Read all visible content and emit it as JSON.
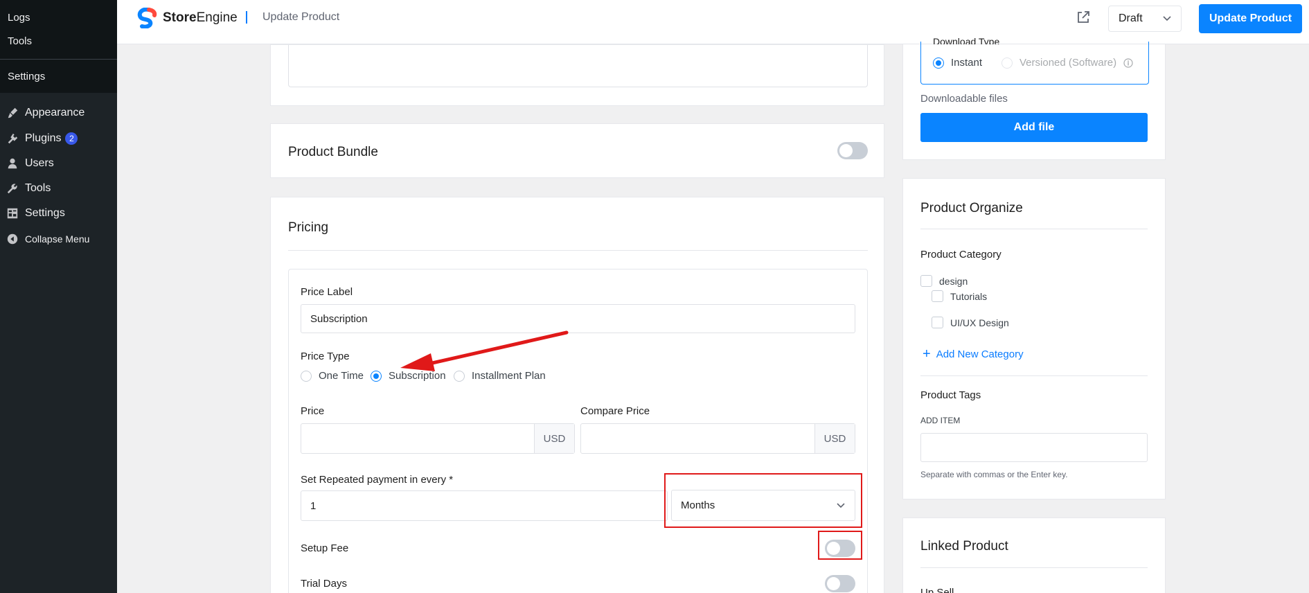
{
  "sidebar": {
    "submenu": [
      {
        "label": "Logs"
      },
      {
        "label": "Tools"
      },
      {
        "label": "Settings"
      }
    ],
    "menu": [
      {
        "label": "Appearance",
        "icon": "brush-icon"
      },
      {
        "label": "Plugins",
        "icon": "plugin-icon",
        "badge": "2"
      },
      {
        "label": "Users",
        "icon": "user-icon"
      },
      {
        "label": "Tools",
        "icon": "wrench-icon"
      },
      {
        "label": "Settings",
        "icon": "settings-icon"
      },
      {
        "label": "Collapse Menu",
        "icon": "collapse-icon"
      }
    ]
  },
  "topbar": {
    "logo_bold": "Store",
    "logo_rest": "Engine",
    "page_title": "Update Product",
    "status": "Draft",
    "update_label": "Update Product"
  },
  "bundle": {
    "title": "Product Bundle"
  },
  "pricing": {
    "title": "Pricing",
    "price_label_label": "Price Label",
    "price_label_value": "Subscription",
    "price_type_label": "Price Type",
    "price_types": [
      "One Time",
      "Subscription",
      "Installment Plan"
    ],
    "selected_price_type": "Subscription",
    "price_label": "Price",
    "compare_price_label": "Compare Price",
    "currency": "USD",
    "repeat_label": "Set Repeated payment in every *",
    "repeat_value": "1",
    "repeat_unit": "Months",
    "setup_fee_label": "Setup Fee",
    "trial_days_label": "Trial Days"
  },
  "download": {
    "type_label": "Download Type",
    "options": [
      "Instant",
      "Versioned (Software)"
    ],
    "files_label": "Downloadable files",
    "add_file_label": "Add file"
  },
  "organize": {
    "title": "Product Organize",
    "category_label": "Product Category",
    "categories": [
      "design",
      "Tutorials",
      "UI/UX Design"
    ],
    "add_category": "Add New Category",
    "tags_label": "Product Tags",
    "add_item_label": "ADD ITEM",
    "tags_help": "Separate with commas or the Enter key."
  },
  "linked": {
    "title": "Linked Product",
    "upsell_label": "Up Sell"
  },
  "colors": {
    "accent": "#0a84ff",
    "annotation": "#e01919",
    "sidebar_bg": "#1d2327"
  }
}
